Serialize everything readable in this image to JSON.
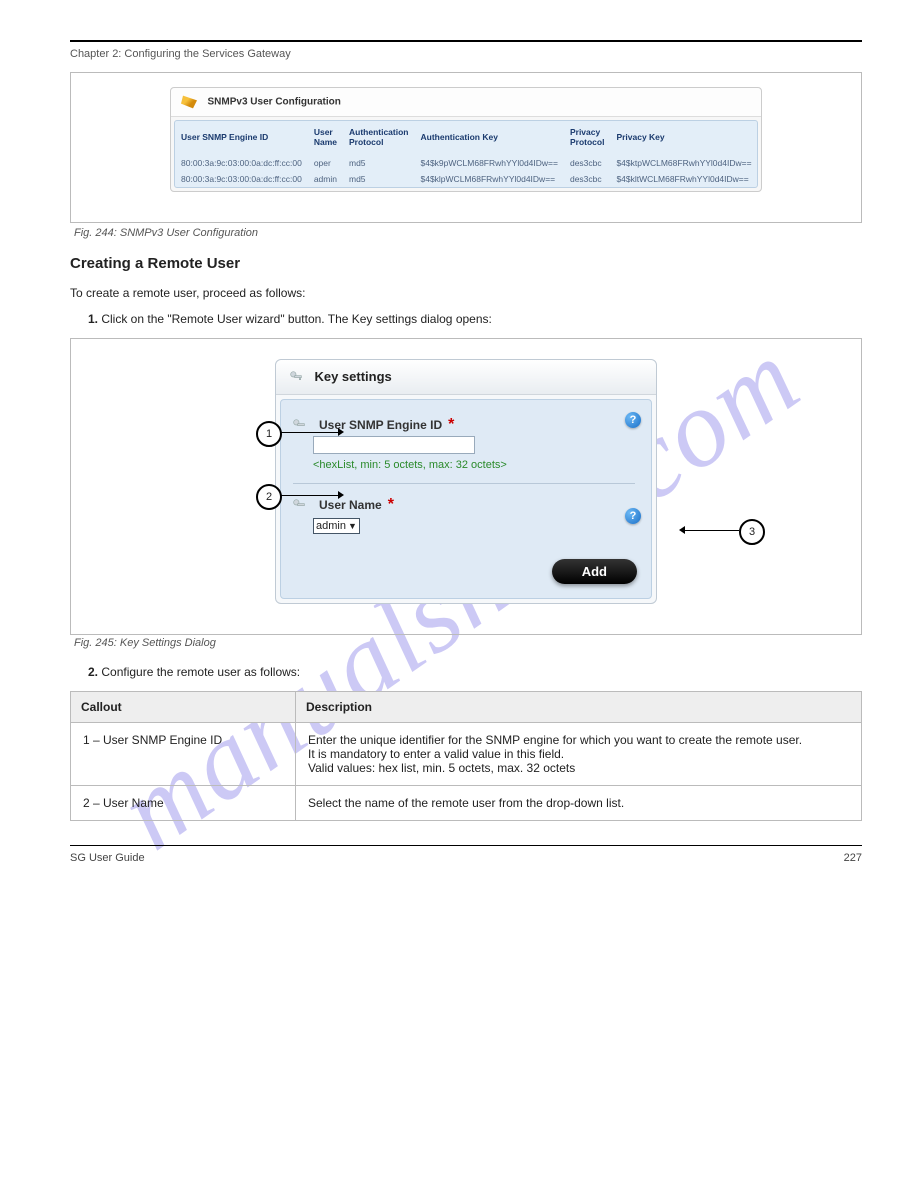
{
  "header": {
    "chapter": "Chapter 2: Configuring the Services Gateway"
  },
  "watermark": "manualshive.com",
  "fig1": {
    "panel_title": "SNMPv3 User Configuration",
    "headers": {
      "engine": "User SNMP Engine ID",
      "uname": "User Name",
      "auth_proto": "Authentication Protocol",
      "auth_key": "Authentication Key",
      "priv_proto": "Privacy Protocol",
      "priv_key": "Privacy Key"
    },
    "rows": [
      {
        "engine": "80:00:3a:9c:03:00:0a:dc:ff:cc:00",
        "uname": "oper",
        "auth_proto": "md5",
        "auth_key": "$4$k9pWCLM68FRwhYYl0d4IDw==",
        "priv_proto": "des3cbc",
        "priv_key": "$4$ktpWCLM68FRwhYYl0d4IDw=="
      },
      {
        "engine": "80:00:3a:9c:03:00:0a:dc:ff:cc:00",
        "uname": "admin",
        "auth_proto": "md5",
        "auth_key": "$4$klpWCLM68FRwhYYl0d4IDw==",
        "priv_proto": "des3cbc",
        "priv_key": "$4$kltWCLM68FRwhYYl0d4IDw=="
      }
    ],
    "caption": "Fig. 244: SNMPv3 User Configuration"
  },
  "section": {
    "heading": "Creating a Remote User",
    "intro": "To create a remote user, proceed as follows:",
    "step1_lead": "1.",
    "step1_text": " Click on the \"Remote User wizard\" button. The Key settings dialog opens:",
    "fig2": {
      "panel_title": "Key settings",
      "field_engine_label": "User SNMP Engine ID",
      "field_engine_hint": "<hexList, min: 5 octets, max: 32 octets>",
      "field_uname_label": "User Name",
      "field_uname_value": "admin",
      "add_label": "Add",
      "callouts": {
        "c1": "1",
        "c2": "2",
        "c3": "3"
      },
      "caption": "Fig. 245: Key Settings Dialog"
    },
    "step2_lead": "2.",
    "step2_text": " Configure the remote user as follows:"
  },
  "desc_table": {
    "h1": "Callout",
    "h2": "Description",
    "rows": [
      {
        "num": "1 – User SNMP Engine ID",
        "desc": "Enter the unique identifier for the SNMP engine for which you want to create the remote user.\nIt is mandatory to enter a valid value in this field.\nValid values: hex list, min. 5 octets, max. 32 octets"
      },
      {
        "num": "2 – User Name",
        "desc": "Select the name of the remote user from the drop-down list."
      }
    ]
  },
  "footer": {
    "doc": "SG User Guide",
    "page": "227"
  }
}
